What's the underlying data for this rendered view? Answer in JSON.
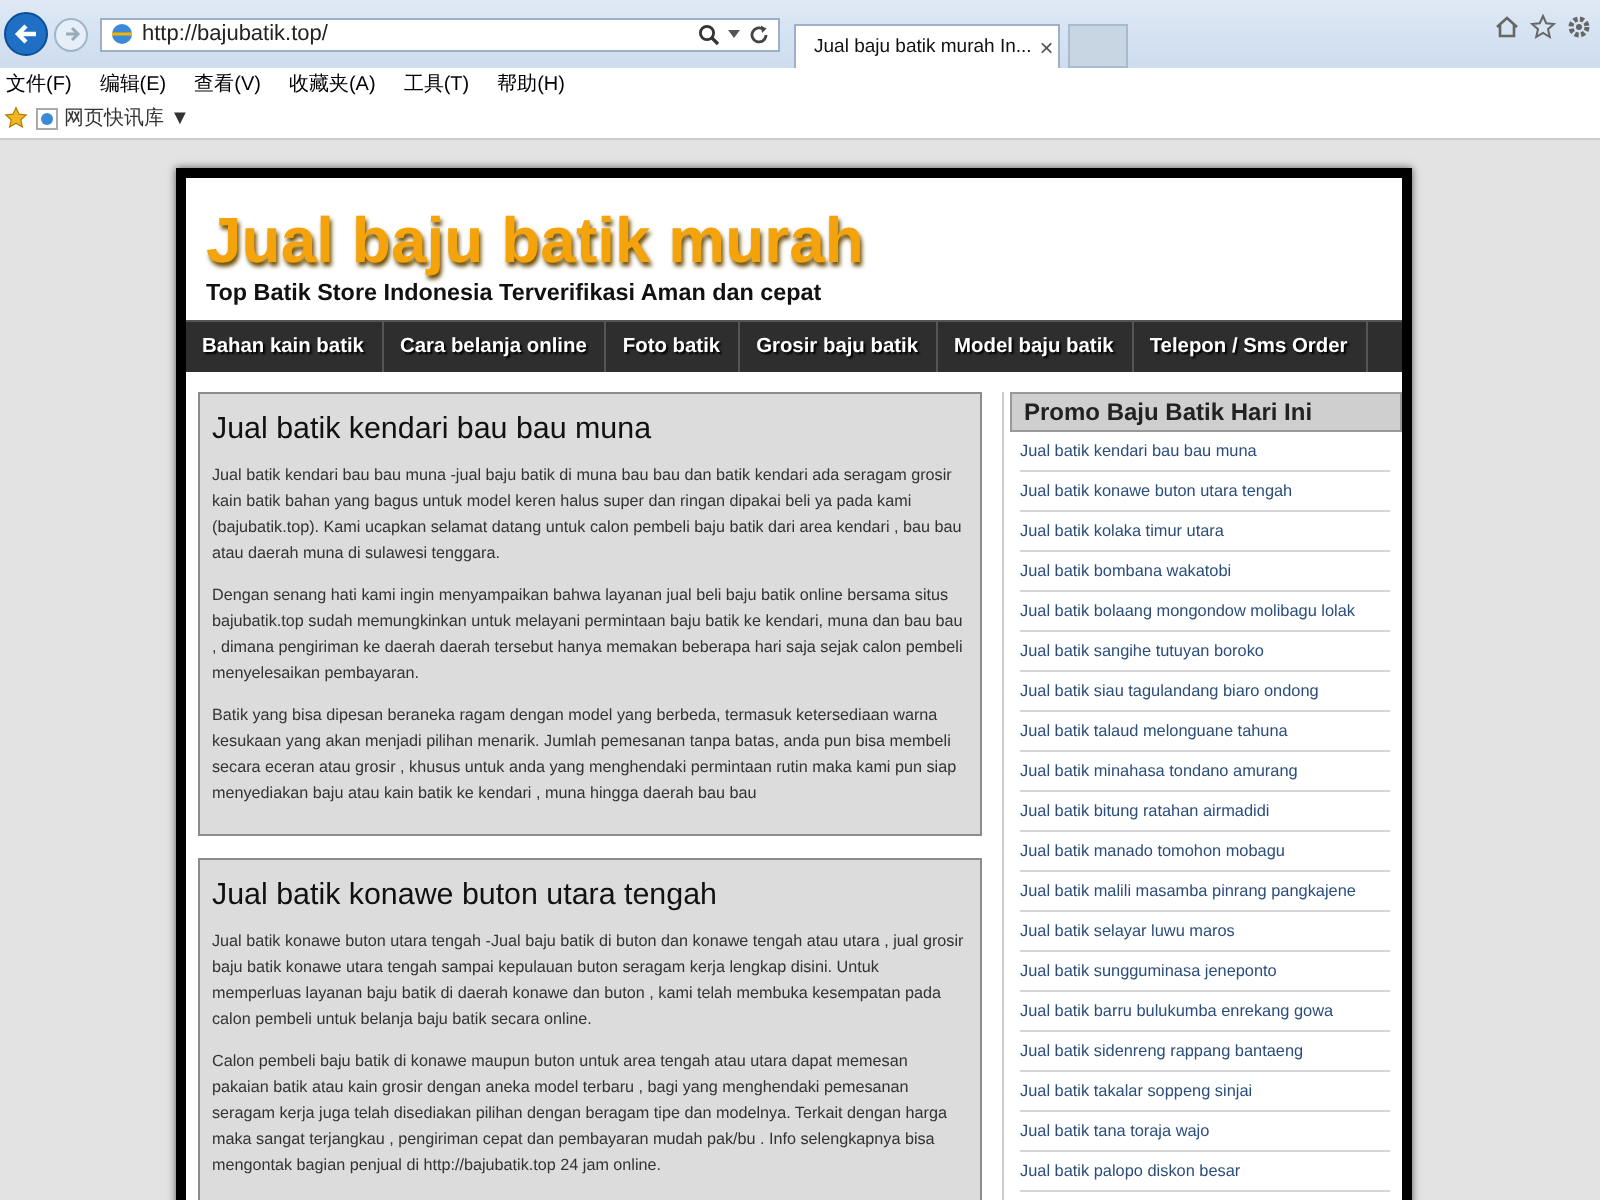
{
  "browser": {
    "address": "http://bajubatik.top/",
    "tab_title": "Jual baju batik murah In...",
    "tab_close": "×",
    "menu": [
      "文件(F)",
      "编辑(E)",
      "查看(V)",
      "收藏夹(A)",
      "工具(T)",
      "帮助(H)"
    ],
    "favorites": {
      "label": "网页快讯库",
      "caret": "▼"
    }
  },
  "site": {
    "title": "Jual baju batik murah",
    "tagline": "Top Batik Store Indonesia Terverifikasi Aman dan cepat"
  },
  "nav": [
    "Bahan kain batik",
    "Cara belanja online",
    "Foto batik",
    "Grosir baju batik",
    "Model baju batik",
    "Telepon / Sms Order"
  ],
  "articles": [
    {
      "title": "Jual batik kendari bau bau muna",
      "paragraphs": [
        "Jual batik kendari bau bau muna -jual baju batik di muna bau bau dan batik kendari ada seragam grosir kain batik bahan yang bagus untuk model keren halus super dan ringan dipakai beli ya pada kami (bajubatik.top). Kami ucapkan selamat datang untuk calon pembeli baju batik dari area kendari , bau bau atau daerah muna di sulawesi tenggara.",
        "Dengan senang hati kami ingin menyampaikan bahwa layanan jual beli baju batik online bersama situs bajubatik.top sudah memungkinkan untuk melayani permintaan baju batik ke kendari, muna dan bau bau , dimana pengiriman ke daerah daerah tersebut hanya memakan beberapa hari saja sejak calon pembeli menyelesaikan pembayaran.",
        "Batik yang bisa dipesan beraneka ragam dengan model yang berbeda, termasuk ketersediaan warna kesukaan yang akan menjadi pilihan menarik. Jumlah pemesanan tanpa batas, anda pun bisa membeli secara eceran atau grosir , khusus untuk anda yang menghendaki permintaan rutin maka kami pun siap menyediakan baju atau kain batik ke kendari , muna hingga daerah bau bau"
      ]
    },
    {
      "title": "Jual batik konawe buton utara tengah",
      "paragraphs": [
        "Jual batik konawe buton utara tengah -Jual baju batik di buton dan konawe tengah atau utara , jual grosir baju batik konawe utara tengah sampai kepulauan buton seragam kerja lengkap disini. Untuk memperluas layanan baju batik di daerah konawe dan buton , kami telah membuka kesempatan pada calon pembeli untuk belanja baju batik secara online.",
        "Calon pembeli baju batik di konawe maupun buton untuk area tengah atau utara dapat memesan pakaian batik atau kain grosir dengan aneka model terbaru , bagi yang menghendaki pemesanan seragam kerja juga telah disediakan pilihan dengan beragam tipe dan modelnya. Terkait dengan harga maka sangat terjangkau , pengiriman cepat dan pembayaran mudah pak/bu . Info selengkapnya bisa mengontak bagian penjual di http://bajubatik.top 24 jam online."
      ]
    }
  ],
  "sidebar": {
    "title": "Promo Baju Batik Hari Ini",
    "links": [
      "Jual batik kendari bau bau muna",
      "Jual batik konawe buton utara tengah",
      "Jual batik kolaka timur utara",
      "Jual batik bombana wakatobi",
      "Jual batik bolaang mongondow molibagu lolak",
      "Jual batik sangihe tutuyan boroko",
      "Jual batik siau tagulandang biaro ondong",
      "Jual batik talaud melonguane tahuna",
      "Jual batik minahasa tondano amurang",
      "Jual batik bitung ratahan airmadidi",
      "Jual batik manado tomohon mobagu",
      "Jual batik malili masamba pinrang pangkajene",
      "Jual batik selayar luwu maros",
      "Jual batik sungguminasa jeneponto",
      "Jual batik barru bulukumba enrekang gowa",
      "Jual batik sidenreng rappang bantaeng",
      "Jual batik takalar soppeng sinjai",
      "Jual batik tana toraja wajo",
      "Jual batik palopo diskon besar"
    ]
  }
}
